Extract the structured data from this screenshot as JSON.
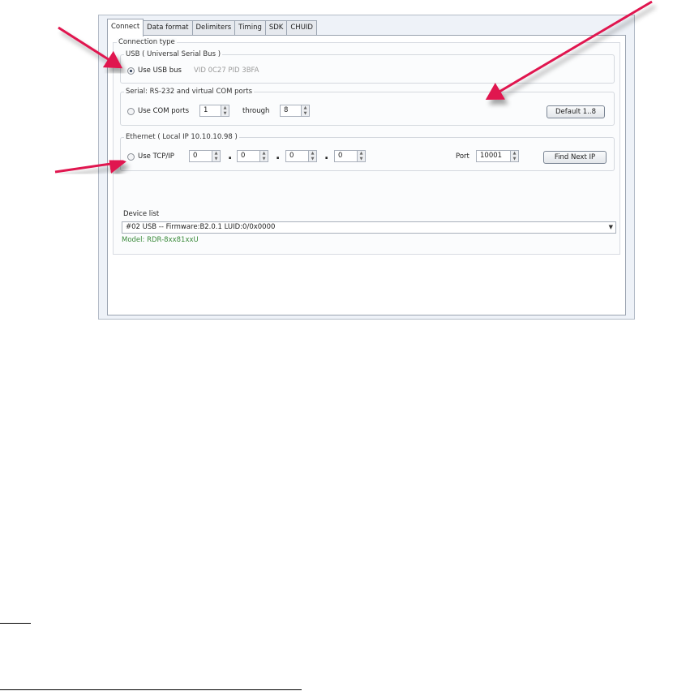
{
  "tabs": [
    {
      "label": "Connect",
      "active": true
    },
    {
      "label": "Data format",
      "active": false
    },
    {
      "label": "Delimiters",
      "active": false
    },
    {
      "label": "Timing",
      "active": false
    },
    {
      "label": "SDK",
      "active": false
    },
    {
      "label": "CHUID",
      "active": false
    }
  ],
  "connection_type": {
    "legend": "Connection type"
  },
  "usb": {
    "legend": "USB ( Universal Serial Bus )",
    "radio_label": "Use USB bus",
    "checked": true,
    "vid_pid": "VID 0C27 PID 3BFA"
  },
  "serial": {
    "legend": "Serial: RS-232 and virtual COM ports",
    "radio_label": "Use COM ports",
    "checked": false,
    "from": "1",
    "through_label": "through",
    "to": "8",
    "default_button": "Default 1..8"
  },
  "ethernet": {
    "legend": "Ethernet ( Local IP 10.10.10.98 )",
    "radio_label": "Use TCP/IP",
    "checked": false,
    "octets": [
      "0",
      "0",
      "0",
      "0"
    ],
    "dot": ".",
    "port_label": "Port",
    "port": "10001",
    "find_button": "Find Next IP"
  },
  "device_list": {
    "label": "Device list",
    "selected": "#02 USB -- Firmware:B2.0.1 LUID:0/0x0000",
    "model": "Model: RDR-8xx81xxU"
  },
  "colors": {
    "annotation_arrow": "#e0174f",
    "model_text": "#3a8a3a"
  }
}
